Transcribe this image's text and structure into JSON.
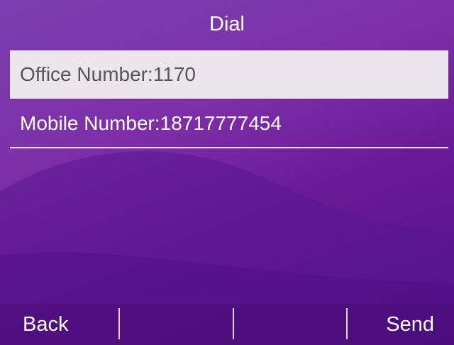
{
  "header": {
    "title": "Dial"
  },
  "numbers": [
    {
      "label": "Office Number:1170",
      "selected": true
    },
    {
      "label": "Mobile Number:18717777454",
      "selected": false
    }
  ],
  "softkeys": {
    "left": "Back",
    "middle_1": "",
    "middle_2": "",
    "right": "Send"
  },
  "colors": {
    "background": "#7a2fa8",
    "selected_row": "#ece5ee",
    "text": "#ffffff"
  }
}
